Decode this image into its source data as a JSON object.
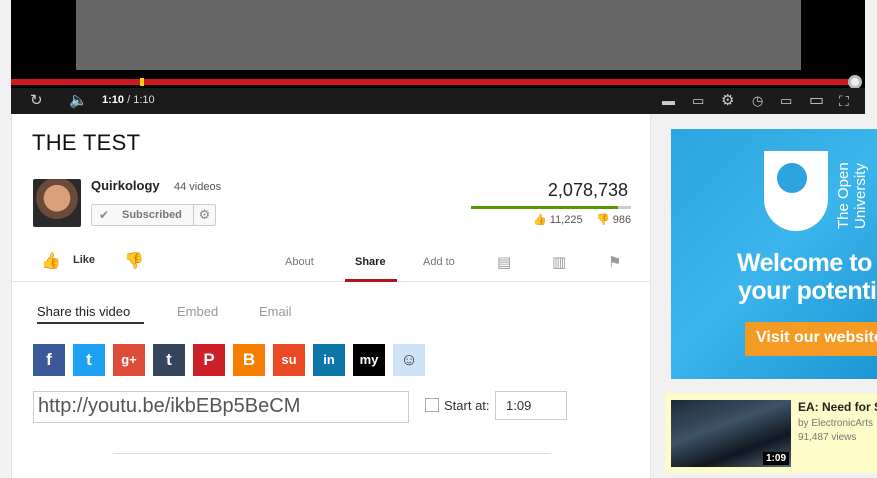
{
  "player": {
    "time_current": "1:10",
    "time_total": " / 1:10",
    "progress_fraction": 1.0,
    "colors": {
      "progress": "#cc181e",
      "marker": "#f2d600"
    }
  },
  "video": {
    "title": "THE TEST",
    "channel": "Quirkology",
    "video_count": "44 videos",
    "subscribe_label": "Subscribed",
    "views": "2,078,738",
    "likes": "11,225",
    "dislikes": "986",
    "like_ratio": 0.92
  },
  "actions": {
    "like_label": "Like",
    "tabs": [
      "About",
      "Share",
      "Add to"
    ],
    "active_tab": "Share"
  },
  "share": {
    "subtabs": [
      "Share this video",
      "Embed",
      "Email"
    ],
    "active_subtab": "Share this video",
    "services": [
      {
        "name": "facebook",
        "glyph": "f",
        "color": "#3b5998"
      },
      {
        "name": "twitter",
        "glyph": "t",
        "color": "#1da1f2"
      },
      {
        "name": "google-plus",
        "glyph": "g+",
        "color": "#dd4b39"
      },
      {
        "name": "tumblr",
        "glyph": "t",
        "color": "#35465c"
      },
      {
        "name": "pinterest",
        "glyph": "P",
        "color": "#cb2027"
      },
      {
        "name": "blogger",
        "glyph": "B",
        "color": "#f57d00"
      },
      {
        "name": "stumbleupon",
        "glyph": "su",
        "color": "#eb4924"
      },
      {
        "name": "linkedin",
        "glyph": "in",
        "color": "#0e76a8"
      },
      {
        "name": "myspace",
        "glyph": "my",
        "color": "#000000"
      },
      {
        "name": "reddit",
        "glyph": "☺",
        "color": "#cee3f8"
      }
    ],
    "url": "http://youtu.be/ikbEBp5BeCM",
    "start_at_label": "Start at:",
    "start_at_value": "1:09"
  },
  "ad": {
    "brand": "The Open University",
    "headline_1": "Welcome to",
    "headline_2": "your potential",
    "cta": "Visit our website"
  },
  "related": {
    "title": "EA: Need for Speed",
    "by": "by ElectronicArts",
    "views": "91,487 views",
    "duration": "1:09"
  }
}
